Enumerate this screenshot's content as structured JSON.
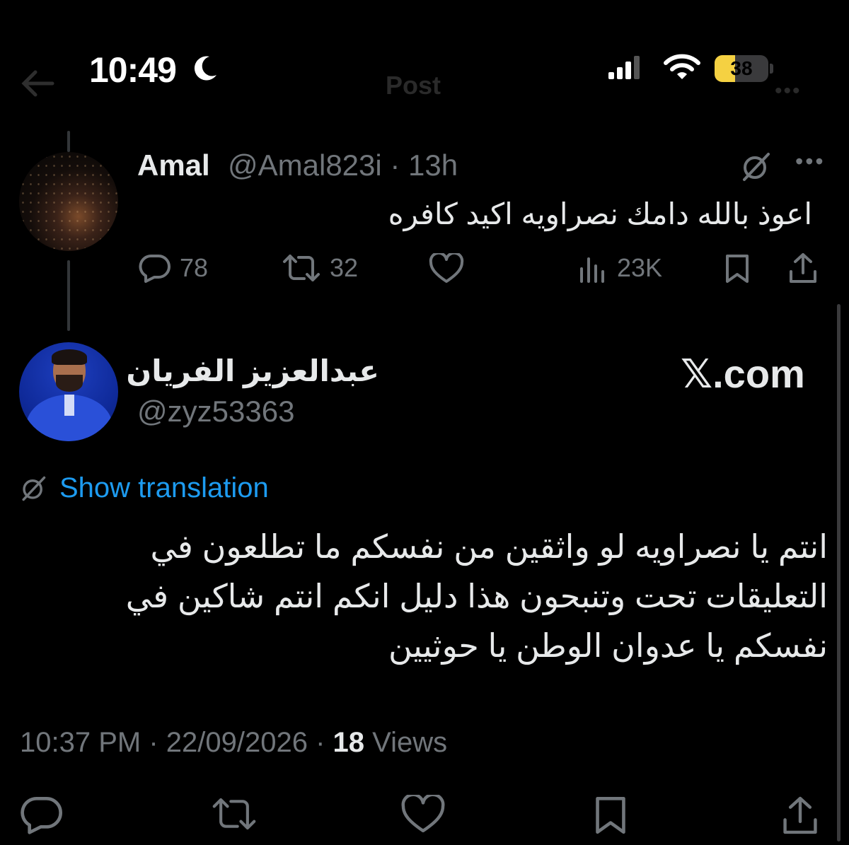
{
  "status_bar": {
    "time": "10:49",
    "battery_level": "38",
    "battery_fraction": 0.38
  },
  "header_ghost": {
    "title": "Post"
  },
  "parent_tweet": {
    "author_name": "Amal",
    "handle_time": "@Amal823i · 13h",
    "text": "اعوذ بالله دامك نصراويه اكيد كافره",
    "replies": "78",
    "reposts": "32",
    "views": "23K",
    "icons": [
      "grok-icon",
      "more-icon",
      "reply-icon",
      "repost-icon",
      "like-icon",
      "views-icon",
      "bookmark-icon",
      "share-icon"
    ]
  },
  "main_tweet": {
    "author_name": "عبدالعزيز الفريان",
    "handle": "@zyz53363",
    "watermark": "𝕏.com",
    "translate_label": "Show translation",
    "text": "انتم يا نصراويه لو واثقين من نفسكم ما تطلعون في التعليقات تحت وتنبحون هذا دليل انكم انتم شاكين في نفسكم يا عدوان الوطن يا حوثيين",
    "timestamp": "10:37 PM · 22/09/2026 · ",
    "views_count": "18",
    "views_label": " Views"
  },
  "colors": {
    "background": "#000000",
    "text": "#e7e9ea",
    "muted": "#71767b",
    "link": "#1d9bf0",
    "battery": "#f5d142"
  }
}
